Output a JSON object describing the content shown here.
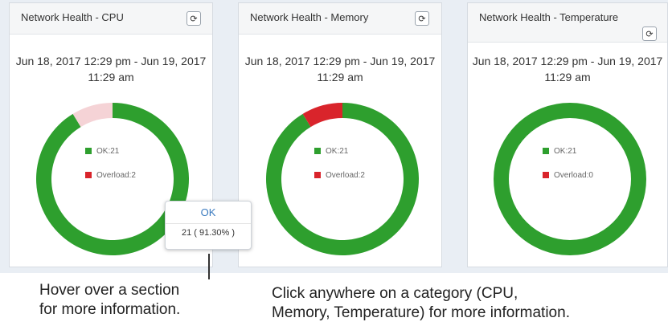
{
  "widgets": [
    {
      "title": "Network Health - CPU",
      "range": "Jun 18, 2017 12:29 pm - Jun 19, 2017 11:29 am",
      "legend_ok": "OK:21",
      "legend_overload": "Overload:2",
      "ok": 21,
      "overload": 2,
      "overload_highlight": true
    },
    {
      "title": "Network Health - Memory",
      "range": "Jun 18, 2017 12:29 pm - Jun 19, 2017 11:29 am",
      "legend_ok": "OK:21",
      "legend_overload": "Overload:2",
      "ok": 21,
      "overload": 2,
      "overload_highlight": false
    },
    {
      "title": "Network Health - Temperature",
      "range": "Jun 18, 2017 12:29 pm - Jun 19, 2017 11:29 am",
      "legend_ok": "OK:21",
      "legend_overload": "Overload:0",
      "ok": 21,
      "overload": 0,
      "overload_highlight": false
    }
  ],
  "refresh_icon": "refresh-icon",
  "colors": {
    "ok": "#2e9f2e",
    "overload": "#d9242b",
    "overload_highlight": "#f5d3d6"
  },
  "tooltip": {
    "title": "OK",
    "value": "21 ( 91.30% )"
  },
  "captions": {
    "hover_line1": "Hover over a section",
    "hover_line2": "for more information.",
    "click_line1": "Click anywhere on a category (CPU,",
    "click_line2": "Memory, Temperature) for more information."
  }
}
